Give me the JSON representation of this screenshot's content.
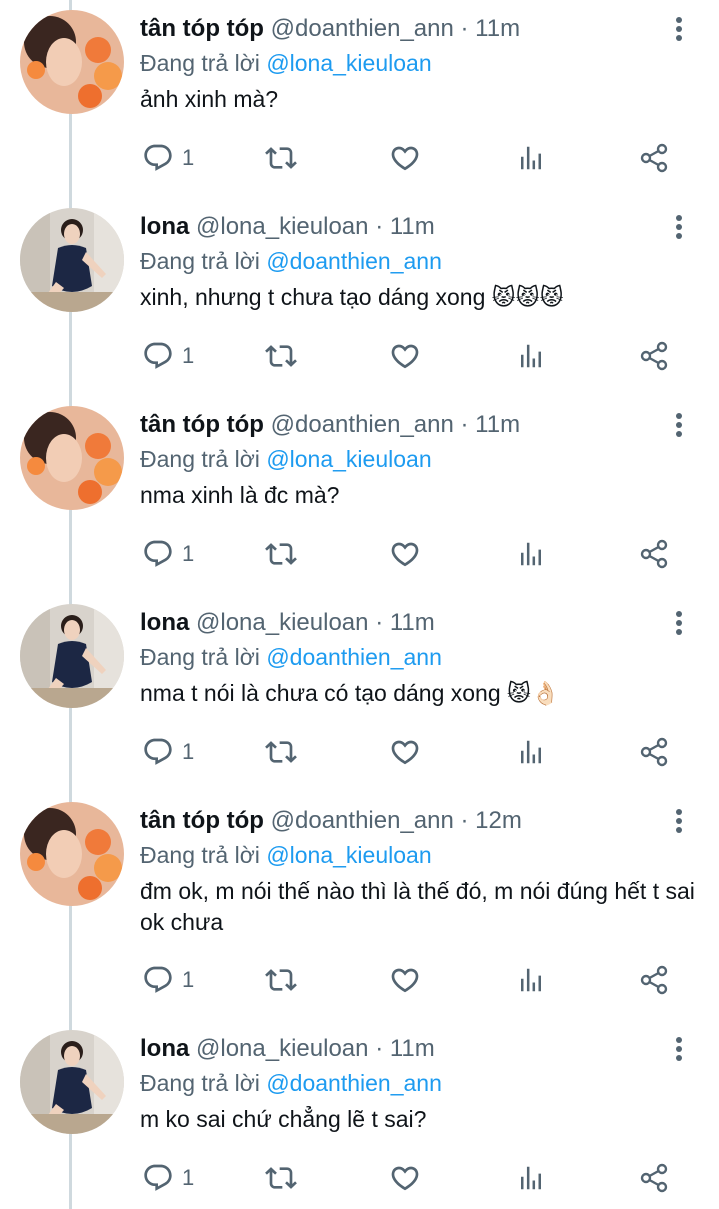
{
  "colors": {
    "text": "#0f1419",
    "muted": "#536471",
    "link": "#1d9bf0",
    "line": "#cfd9de"
  },
  "icons": {
    "reply": "reply-icon",
    "retweet": "retweet-icon",
    "like": "heart-icon",
    "views": "views-icon",
    "share": "share-icon",
    "more": "more-vertical-icon"
  },
  "reply_prefix": "Đang trả lời",
  "tweets": [
    {
      "author": "tân tóp tóp",
      "handle": "@doanthien_ann",
      "dot": "·",
      "time": "11m",
      "reply_to": "@lona_kieuloan",
      "text": "ảnh xinh mà?",
      "reply_count": "1"
    },
    {
      "author": "lona",
      "handle": "@lona_kieuloan",
      "dot": "·",
      "time": "11m",
      "reply_to": "@doanthien_ann",
      "text": "xinh, nhưng t chưa tạo dáng xong 😾😾😾",
      "reply_count": "1"
    },
    {
      "author": "tân tóp tóp",
      "handle": "@doanthien_ann",
      "dot": "·",
      "time": "11m",
      "reply_to": "@lona_kieuloan",
      "text": "nma xinh là đc mà?",
      "reply_count": "1"
    },
    {
      "author": "lona",
      "handle": "@lona_kieuloan",
      "dot": "·",
      "time": "11m",
      "reply_to": "@doanthien_ann",
      "text": "nma t nói là chưa có tạo dáng xong 😾👌🏻",
      "reply_count": "1"
    },
    {
      "author": "tân tóp tóp",
      "handle": "@doanthien_ann",
      "dot": "·",
      "time": "12m",
      "reply_to": "@lona_kieuloan",
      "text": "đm ok, m nói thế nào thì là thế đó, m nói đúng hết t sai ok chưa",
      "reply_count": "1"
    },
    {
      "author": "lona",
      "handle": "@lona_kieuloan",
      "dot": "·",
      "time": "11m",
      "reply_to": "@doanthien_ann",
      "text": "m ko sai chứ chẳng lẽ t sai?",
      "reply_count": "1"
    }
  ]
}
